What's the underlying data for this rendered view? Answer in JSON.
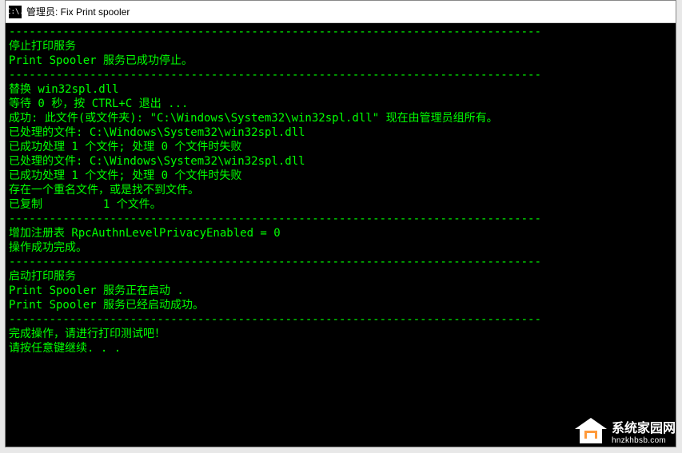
{
  "window": {
    "icon_label": "C:\\.",
    "title": "管理员:  Fix Print spooler"
  },
  "terminal": {
    "lines": [
      "-------------------------------------------------------------------------------",
      "停止打印服务",
      "",
      "Print Spooler 服务已成功停止。",
      "",
      "-------------------------------------------------------------------------------",
      "替换 win32spl.dll",
      "",
      "",
      "等待 0 秒，按 CTRL+C 退出 ...",
      "",
      "成功: 此文件(或文件夹): \"C:\\Windows\\System32\\win32spl.dll\" 现在由管理员组所有。",
      "已处理的文件: C:\\Windows\\System32\\win32spl.dll",
      "已成功处理 1 个文件; 处理 0 个文件时失败",
      "已处理的文件: C:\\Windows\\System32\\win32spl.dll",
      "已成功处理 1 个文件; 处理 0 个文件时失败",
      "存在一个重名文件，或是找不到文件。",
      "已复制         1 个文件。",
      "-------------------------------------------------------------------------------",
      "增加注册表 RpcAuthnLevelPrivacyEnabled = 0",
      "",
      "操作成功完成。",
      "-------------------------------------------------------------------------------",
      "启动打印服务",
      "Print Spooler 服务正在启动 .",
      "Print Spooler 服务已经启动成功。",
      "",
      "-------------------------------------------------------------------------------",
      "完成操作，请进行打印测试吧！",
      "请按任意键继续. . ."
    ]
  },
  "watermark": {
    "name": "系统家园网",
    "domain": "hnzkhbsb.com"
  }
}
